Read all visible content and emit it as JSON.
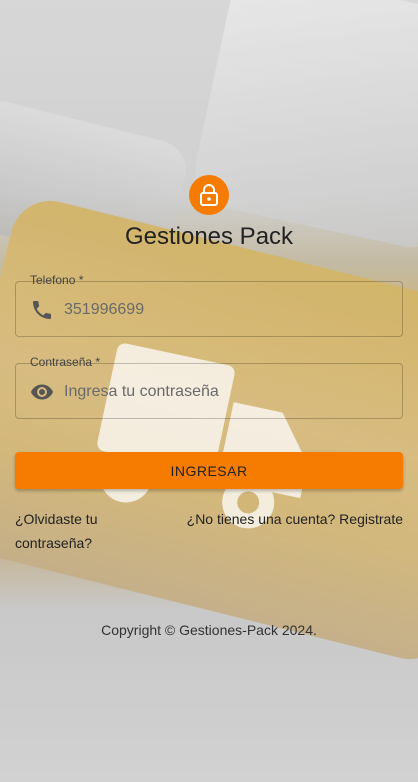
{
  "app": {
    "title": "Gestiones Pack",
    "brand_color": "#f57c00"
  },
  "icons": {
    "logo": "lock-icon",
    "phone": "phone-icon",
    "password": "eye-icon"
  },
  "form": {
    "phone": {
      "label": "Telefono *",
      "placeholder": "351996699"
    },
    "password": {
      "label": "Contraseña *",
      "placeholder": "Ingresa tu contraseña"
    },
    "submit_label": "INGRESAR"
  },
  "links": {
    "forgot": "¿Olvidaste tu contraseña?",
    "register": "¿No tienes una cuenta? Registrate"
  },
  "footer": {
    "copyright": "Copyright © Gestiones-Pack 2024."
  }
}
